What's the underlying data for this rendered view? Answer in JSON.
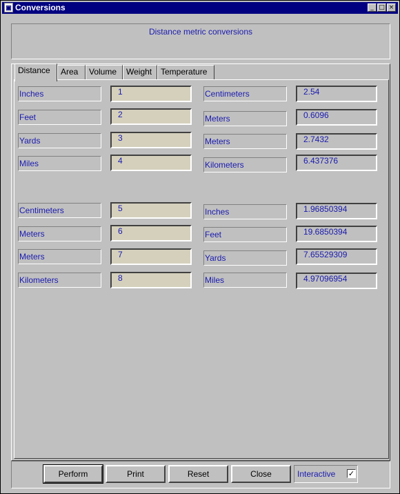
{
  "window": {
    "title": "Conversions",
    "icon": "app-window-icon"
  },
  "title_buttons": {
    "minimize": "_",
    "maximize": "□",
    "close": "×"
  },
  "header": {
    "text": "Distance metric conversions"
  },
  "tabs": [
    {
      "label": "Distance",
      "active": true
    },
    {
      "label": "Area"
    },
    {
      "label": "Volume"
    },
    {
      "label": "Weight"
    },
    {
      "label": "Temperature"
    }
  ],
  "rows": [
    {
      "from": "Inches",
      "value": "1",
      "to": "Centimeters",
      "result": "2.54"
    },
    {
      "from": "Feet",
      "value": "2",
      "to": "Meters",
      "result": "0.6096"
    },
    {
      "from": "Yards",
      "value": "3",
      "to": "Meters",
      "result": "2.7432"
    },
    {
      "from": "Miles",
      "value": "4",
      "to": "Kilometers",
      "result": "6.437376"
    },
    {
      "from": "Centimeters",
      "value": "5",
      "to": "Inches",
      "result": "1.96850394"
    },
    {
      "from": "Meters",
      "value": "6",
      "to": "Feet",
      "result": "19.6850394"
    },
    {
      "from": "Meters",
      "value": "7",
      "to": "Yards",
      "result": "7.65529309"
    },
    {
      "from": "Kilometers",
      "value": "8",
      "to": "Miles",
      "result": "4.97096954"
    }
  ],
  "buttons": {
    "perform": "Perform",
    "print": "Print",
    "reset": "Reset",
    "close": "Close"
  },
  "interactive": {
    "label": "Interactive",
    "checked": true,
    "check_glyph": "✓"
  },
  "colors": {
    "titlebar": "#000080",
    "text_accent": "#1a1ab0",
    "input_bg": "#d4d0bc",
    "face": "#c0c0c0"
  }
}
